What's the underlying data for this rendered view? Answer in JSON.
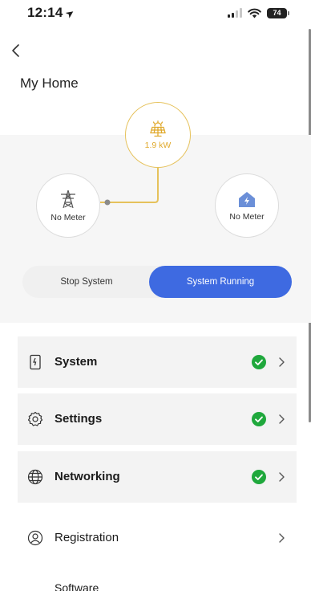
{
  "status_bar": {
    "time": "12:14",
    "battery_level": "74",
    "icons": [
      "location-arrow-icon",
      "cellular-signal-icon",
      "wifi-icon",
      "battery-icon"
    ]
  },
  "header": {
    "back_icon": "back-chevron-icon",
    "title": "My Home"
  },
  "energy_flow": {
    "solar": {
      "icon": "solar-panel-icon",
      "value": "1.9 kW",
      "color": "#e0a92b"
    },
    "grid": {
      "icon": "power-tower-icon",
      "label": "No Meter"
    },
    "home": {
      "icon": "home-bolt-icon",
      "label": "No Meter",
      "color": "#6b8fd8"
    }
  },
  "system_toggle": {
    "stop_label": "Stop System",
    "running_label": "System Running",
    "active": "running",
    "accent_color": "#3e6ae1"
  },
  "menu": {
    "items": [
      {
        "label": "System",
        "icon": "inverter-icon",
        "status": "ok",
        "status_color": "#1fa83c"
      },
      {
        "label": "Settings",
        "icon": "gear-icon",
        "status": "ok",
        "status_color": "#1fa83c"
      },
      {
        "label": "Networking",
        "icon": "globe-icon",
        "status": "ok",
        "status_color": "#1fa83c"
      },
      {
        "label": "Registration",
        "icon": "user-circle-icon"
      },
      {
        "label": "Software"
      }
    ]
  }
}
